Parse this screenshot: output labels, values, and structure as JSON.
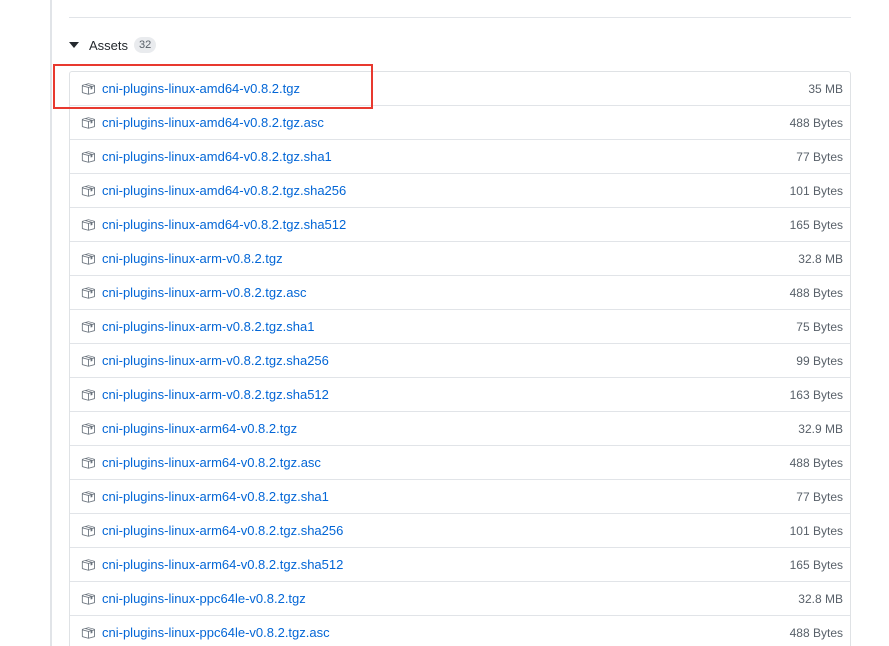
{
  "assets": {
    "title": "Assets",
    "count": "32",
    "items": [
      {
        "name": "cni-plugins-linux-amd64-v0.8.2.tgz",
        "size": "35 MB"
      },
      {
        "name": "cni-plugins-linux-amd64-v0.8.2.tgz.asc",
        "size": "488 Bytes"
      },
      {
        "name": "cni-plugins-linux-amd64-v0.8.2.tgz.sha1",
        "size": "77 Bytes"
      },
      {
        "name": "cni-plugins-linux-amd64-v0.8.2.tgz.sha256",
        "size": "101 Bytes"
      },
      {
        "name": "cni-plugins-linux-amd64-v0.8.2.tgz.sha512",
        "size": "165 Bytes"
      },
      {
        "name": "cni-plugins-linux-arm-v0.8.2.tgz",
        "size": "32.8 MB"
      },
      {
        "name": "cni-plugins-linux-arm-v0.8.2.tgz.asc",
        "size": "488 Bytes"
      },
      {
        "name": "cni-plugins-linux-arm-v0.8.2.tgz.sha1",
        "size": "75 Bytes"
      },
      {
        "name": "cni-plugins-linux-arm-v0.8.2.tgz.sha256",
        "size": "99 Bytes"
      },
      {
        "name": "cni-plugins-linux-arm-v0.8.2.tgz.sha512",
        "size": "163 Bytes"
      },
      {
        "name": "cni-plugins-linux-arm64-v0.8.2.tgz",
        "size": "32.9 MB"
      },
      {
        "name": "cni-plugins-linux-arm64-v0.8.2.tgz.asc",
        "size": "488 Bytes"
      },
      {
        "name": "cni-plugins-linux-arm64-v0.8.2.tgz.sha1",
        "size": "77 Bytes"
      },
      {
        "name": "cni-plugins-linux-arm64-v0.8.2.tgz.sha256",
        "size": "101 Bytes"
      },
      {
        "name": "cni-plugins-linux-arm64-v0.8.2.tgz.sha512",
        "size": "165 Bytes"
      },
      {
        "name": "cni-plugins-linux-ppc64le-v0.8.2.tgz",
        "size": "32.8 MB"
      },
      {
        "name": "cni-plugins-linux-ppc64le-v0.8.2.tgz.asc",
        "size": "488 Bytes"
      }
    ]
  },
  "colors": {
    "link": "#0366d6",
    "muted": "#586069",
    "border": "#e1e4e8",
    "highlight": "#e8392f"
  },
  "icons": {
    "asset": "package-icon",
    "collapse": "caret-down-icon"
  }
}
